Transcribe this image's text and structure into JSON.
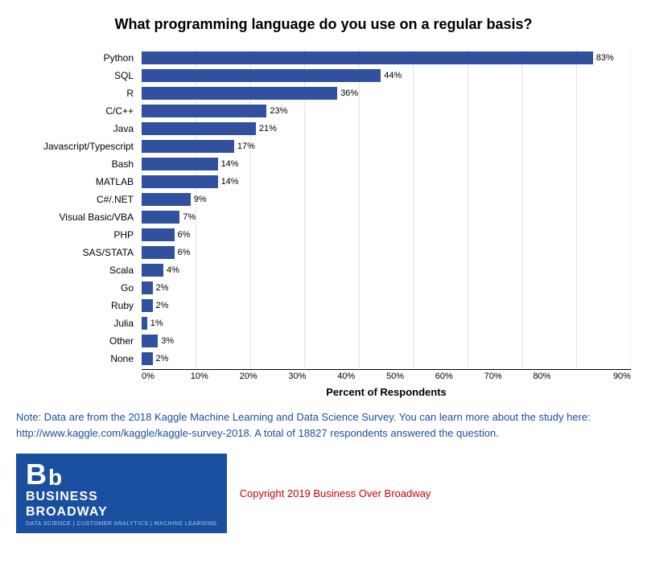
{
  "title": "What programming language do you use on a regular basis?",
  "bars": [
    {
      "label": "Python",
      "value": 83,
      "display": "83%"
    },
    {
      "label": "SQL",
      "value": 44,
      "display": "44%"
    },
    {
      "label": "R",
      "value": 36,
      "display": "36%"
    },
    {
      "label": "C/C++",
      "value": 23,
      "display": "23%"
    },
    {
      "label": "Java",
      "value": 21,
      "display": "21%"
    },
    {
      "label": "Javascript/Typescript",
      "value": 17,
      "display": "17%"
    },
    {
      "label": "Bash",
      "value": 14,
      "display": "14%"
    },
    {
      "label": "MATLAB",
      "value": 14,
      "display": "14%"
    },
    {
      "label": "C#/.NET",
      "value": 9,
      "display": "9%"
    },
    {
      "label": "Visual Basic/VBA",
      "value": 7,
      "display": "7%"
    },
    {
      "label": "PHP",
      "value": 6,
      "display": "6%"
    },
    {
      "label": "SAS/STATA",
      "value": 6,
      "display": "6%"
    },
    {
      "label": "Scala",
      "value": 4,
      "display": "4%"
    },
    {
      "label": "Go",
      "value": 2,
      "display": "2%"
    },
    {
      "label": "Ruby",
      "value": 2,
      "display": "2%"
    },
    {
      "label": "Julia",
      "value": 1,
      "display": "1%"
    },
    {
      "label": "Other",
      "value": 3,
      "display": "3%"
    },
    {
      "label": "None",
      "value": 2,
      "display": "2%"
    }
  ],
  "x_axis": {
    "label": "Percent of Respondents",
    "ticks": [
      "0%",
      "10%",
      "20%",
      "30%",
      "40%",
      "50%",
      "60%",
      "70%",
      "80%",
      "90%"
    ],
    "max": 90
  },
  "note": "Note: Data are from the 2018 Kaggle Machine Learning and Data Science Survey. You can learn more about the study here: http://www.kaggle.com/kaggle/kaggle-survey-2018.  A total of 18827 respondents answered the question.",
  "copyright": "Copyright 2019 Business Over Broadway",
  "logo": {
    "letters": "Bb",
    "line1": "BUSINESS",
    "line2": "BROADWAY",
    "sub": "DATA SCIENCE | CUSTOMER ANALYTICS | MACHINE LEARNING"
  }
}
